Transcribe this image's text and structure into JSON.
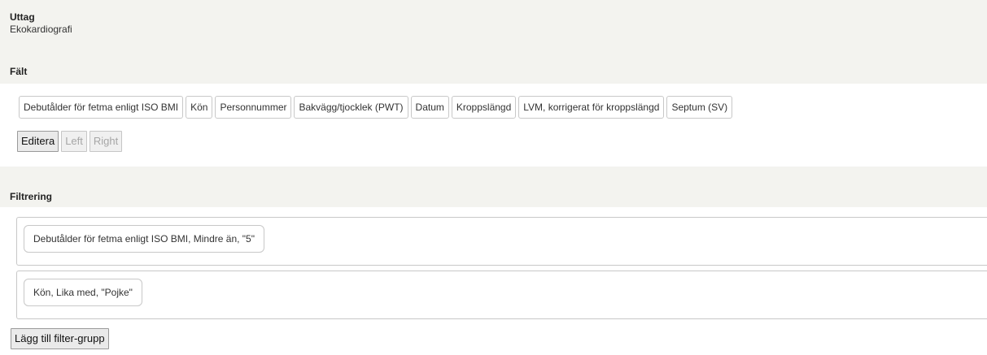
{
  "output": {
    "heading": "Uttag",
    "value": "Ekokardiografi"
  },
  "fields": {
    "heading": "Fält",
    "items": [
      "Debutålder för fetma enligt ISO BMI",
      "Kön",
      "Personnummer",
      "Bakvägg/tjocklek (PWT)",
      "Datum",
      "Kroppslängd",
      "LVM, korrigerat för kroppslängd",
      "Septum (SV)"
    ],
    "buttons": {
      "edit": "Editera",
      "left": "Left",
      "right": "Right"
    }
  },
  "filtering": {
    "heading": "Filtrering",
    "groups": [
      "Debutålder för fetma enligt ISO BMI, Mindre än, \"5\"",
      "Kön, Lika med, \"Pojke\""
    ],
    "add_group_label": "Lägg till filter-grupp"
  }
}
